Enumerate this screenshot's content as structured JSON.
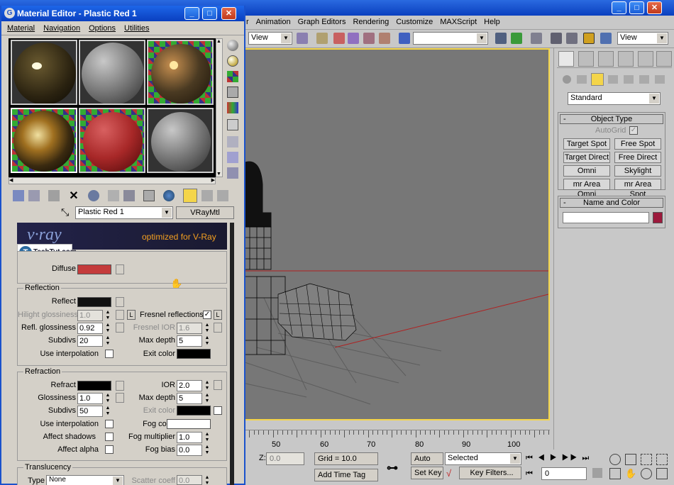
{
  "max": {
    "menus": [
      "r",
      "Animation",
      "Graph Editors",
      "Rendering",
      "Customize",
      "MAXScript",
      "Help"
    ],
    "viewport_combo": "View",
    "ref_combo": "View",
    "panel_type_combo": "Standard",
    "object_type": {
      "header": "Object Type",
      "autogrid": "AutoGrid",
      "buttons": [
        "Target Spot",
        "Free Spot",
        "Target Direct",
        "Free Direct",
        "Omni",
        "Skylight",
        "mr Area Omni",
        "mr Area Spot"
      ]
    },
    "name_and_color": {
      "header": "Name and Color",
      "minus": "-"
    },
    "object_type_minus": "-",
    "timeline": {
      "labels": [
        "50",
        "60",
        "70",
        "80",
        "90",
        "100"
      ]
    },
    "status": {
      "z_label": "Z:",
      "z_value": "0.0",
      "grid": "Grid = 10.0",
      "add_time_tag": "Add Time Tag",
      "auto_key": "Auto Key",
      "selected": "Selected",
      "set_key": "Set Key",
      "key_filters": "Key Filters...",
      "frame": "0"
    }
  },
  "me": {
    "title": "Material Editor - Plastic Red 1",
    "logo": "G",
    "menus": [
      "Material",
      "Navigation",
      "Options",
      "Utilities"
    ],
    "material_name": "Plastic Red 1",
    "material_type": "VRayMtl",
    "banner": {
      "logo": "v·ray",
      "tagline": "optimized for V-Ray"
    },
    "watermark": {
      "letter": "T",
      "text": "TechTut.com"
    },
    "diffuse_label": "Diffuse",
    "reflection": {
      "title": "Reflection",
      "reflect": "Reflect",
      "hilight_glossiness": "Hilight glossiness",
      "hilight_value": "1.0",
      "lock": "L",
      "fresnel": "Fresnel reflections",
      "fresnel_lock": "L",
      "refl_glossiness": "Refl. glossiness",
      "refl_value": "0.92",
      "fresnel_ior": "Fresnel IOR",
      "fresnel_ior_value": "1.6",
      "subdivs": "Subdivs",
      "subdivs_value": "20",
      "max_depth": "Max depth",
      "max_depth_value": "5",
      "use_interpolation": "Use interpolation",
      "exit_color": "Exit color"
    },
    "refraction": {
      "title": "Refraction",
      "refract": "Refract",
      "ior": "IOR",
      "ior_value": "2.0",
      "glossiness": "Glossiness",
      "glossiness_value": "1.0",
      "max_depth": "Max depth",
      "max_depth_value": "5",
      "subdivs": "Subdivs",
      "subdivs_value": "50",
      "exit_color": "Exit color",
      "use_interpolation": "Use interpolation",
      "fog_color": "Fog color",
      "affect_shadows": "Affect shadows",
      "fog_multiplier": "Fog multiplier",
      "fog_multiplier_value": "1.0",
      "affect_alpha": "Affect alpha",
      "fog_bias": "Fog bias",
      "fog_bias_value": "0.0"
    },
    "translucency": {
      "title": "Translucency",
      "type": "Type",
      "type_value": "None",
      "scatter_coeff": "Scatter coeff",
      "scatter_value": "0.0"
    }
  },
  "colors": {
    "diffuse": "#c43b3b",
    "name_color": "#9c1a3c",
    "viewport_border": "#f4d54a"
  }
}
